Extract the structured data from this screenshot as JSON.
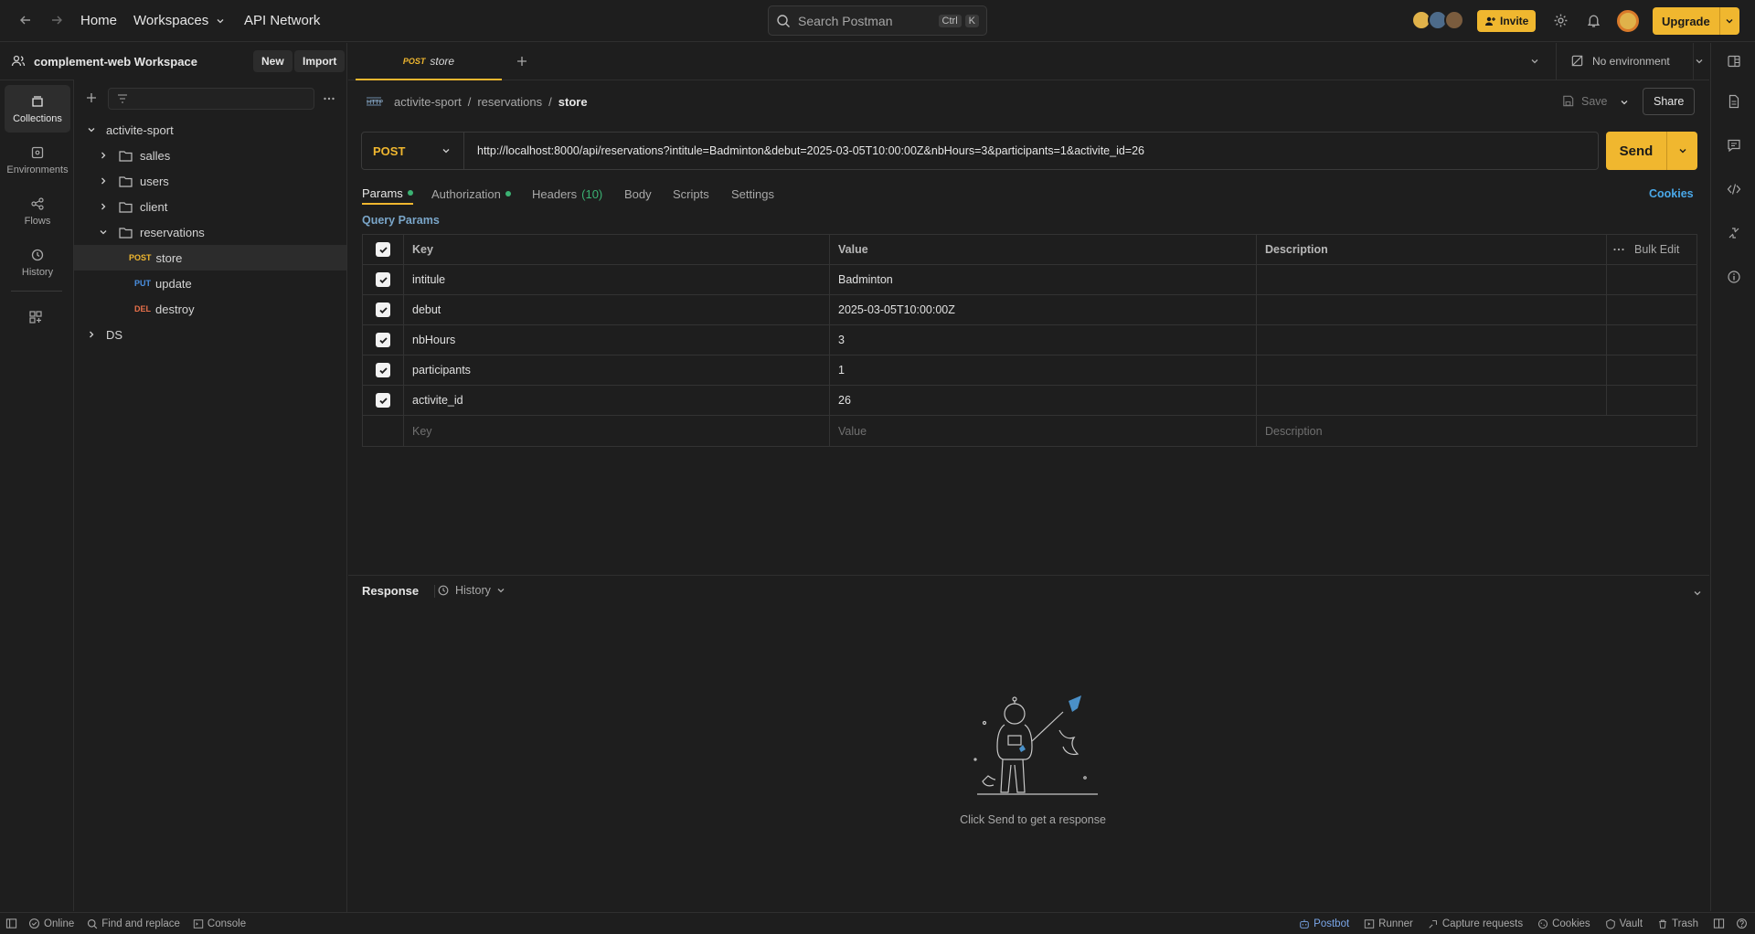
{
  "topbar": {
    "home": "Home",
    "workspaces": "Workspaces",
    "api_network": "API Network",
    "search_placeholder": "Search Postman",
    "kbd_ctrl": "Ctrl",
    "kbd_k": "K",
    "invite": "Invite",
    "upgrade": "Upgrade"
  },
  "workspace": {
    "name": "complement-web Workspace",
    "new_label": "New",
    "import_label": "Import"
  },
  "rail": [
    {
      "label": "Collections",
      "icon": "collections-icon"
    },
    {
      "label": "Environments",
      "icon": "environments-icon"
    },
    {
      "label": "Flows",
      "icon": "flows-icon"
    },
    {
      "label": "History",
      "icon": "history-icon"
    }
  ],
  "tree": {
    "root": "activite-sport",
    "folders": [
      "salles",
      "users",
      "client",
      "reservations"
    ],
    "requests": [
      {
        "method": "POST",
        "name": "store",
        "color": "#f0b72f"
      },
      {
        "method": "PUT",
        "name": "update",
        "color": "#4a90e2"
      },
      {
        "method": "DEL",
        "name": "destroy",
        "color": "#e8704a"
      }
    ],
    "other": "DS"
  },
  "tab": {
    "method": "POST",
    "name": "store"
  },
  "env": {
    "label": "No environment"
  },
  "breadcrumb": {
    "part1": "activite-sport",
    "part2": "reservations",
    "part3": "store",
    "save": "Save",
    "share": "Share"
  },
  "request": {
    "method": "POST",
    "url": "http://localhost:8000/api/reservations?intitule=Badminton&debut=2025-03-05T10:00:00Z&nbHours=3&participants=1&activite_id=26",
    "send": "Send"
  },
  "subtabs": {
    "params": "Params",
    "authorization": "Authorization",
    "headers": "Headers",
    "headers_count": "(10)",
    "body": "Body",
    "scripts": "Scripts",
    "settings": "Settings",
    "cookies": "Cookies"
  },
  "query": {
    "title": "Query Params",
    "col_key": "Key",
    "col_value": "Value",
    "col_desc": "Description",
    "bulk_edit": "Bulk Edit",
    "rows": [
      {
        "key": "intitule",
        "value": "Badminton"
      },
      {
        "key": "debut",
        "value": "2025-03-05T10:00:00Z"
      },
      {
        "key": "nbHours",
        "value": "3"
      },
      {
        "key": "participants",
        "value": "1"
      },
      {
        "key": "activite_id",
        "value": "26"
      }
    ],
    "ph_key": "Key",
    "ph_value": "Value",
    "ph_desc": "Description"
  },
  "response": {
    "title": "Response",
    "history": "History",
    "empty": "Click Send to get a response"
  },
  "status": {
    "online": "Online",
    "find": "Find and replace",
    "console": "Console",
    "postbot": "Postbot",
    "runner": "Runner",
    "capture": "Capture requests",
    "cookies": "Cookies",
    "vault": "Vault",
    "trash": "Trash"
  }
}
